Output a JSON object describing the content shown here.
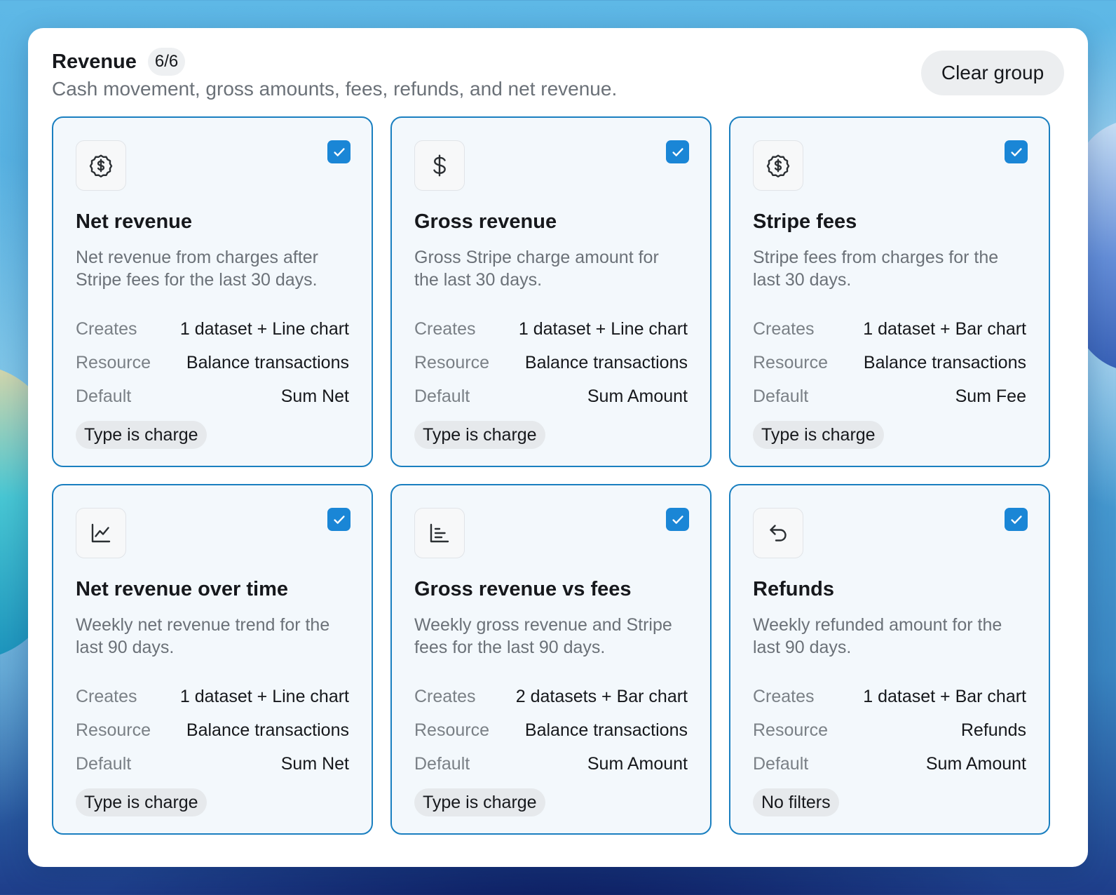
{
  "group": {
    "title": "Revenue",
    "count": "6/6",
    "description": "Cash movement, gross amounts, fees, refunds, and net revenue.",
    "clear_label": "Clear group"
  },
  "labels": {
    "creates": "Creates",
    "resource": "Resource",
    "default": "Default"
  },
  "cards": [
    {
      "icon": "dollar-circle-icon",
      "title": "Net revenue",
      "description": "Net revenue from charges after Stripe fees for the last 30 days.",
      "creates": "1 dataset + Line chart",
      "resource": "Balance transactions",
      "default": "Sum Net",
      "filter": "Type is charge",
      "checked": true
    },
    {
      "icon": "dollar-sign-icon",
      "title": "Gross revenue",
      "description": "Gross Stripe charge amount for the last 30 days.",
      "creates": "1 dataset + Line chart",
      "resource": "Balance transactions",
      "default": "Sum Amount",
      "filter": "Type is charge",
      "checked": true
    },
    {
      "icon": "dollar-circle-icon",
      "title": "Stripe fees",
      "description": "Stripe fees from charges for the last 30 days.",
      "creates": "1 dataset + Bar chart",
      "resource": "Balance transactions",
      "default": "Sum Fee",
      "filter": "Type is charge",
      "checked": true
    },
    {
      "icon": "line-chart-icon",
      "title": "Net revenue over time",
      "description": "Weekly net revenue trend for the last 90 days.",
      "creates": "1 dataset + Line chart",
      "resource": "Balance transactions",
      "default": "Sum Net",
      "filter": "Type is charge",
      "checked": true
    },
    {
      "icon": "bar-chart-horizontal-icon",
      "title": "Gross revenue vs fees",
      "description": "Weekly gross revenue and Stripe fees for the last 90 days.",
      "creates": "2 datasets + Bar chart",
      "resource": "Balance transactions",
      "default": "Sum Amount",
      "filter": "Type is charge",
      "checked": true
    },
    {
      "icon": "undo-arrow-icon",
      "title": "Refunds",
      "description": "Weekly refunded amount for the last 90 days.",
      "creates": "1 dataset + Bar chart",
      "resource": "Refunds",
      "default": "Sum Amount",
      "filter": "No filters",
      "checked": true
    }
  ],
  "colors": {
    "accent": "#1a86d6",
    "card_border": "#1a7fc0",
    "card_bg": "#f3f8fc"
  }
}
